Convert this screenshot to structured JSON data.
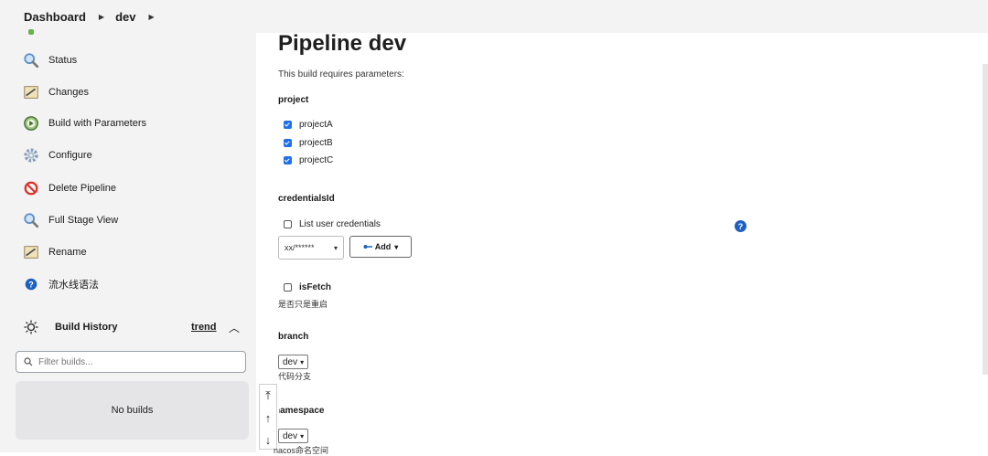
{
  "breadcrumb": [
    "Dashboard",
    "dev"
  ],
  "sidebar": {
    "items": [
      {
        "label": "Status",
        "icon": "magnifier-icon"
      },
      {
        "label": "Changes",
        "icon": "notepad-icon"
      },
      {
        "label": "Build with Parameters",
        "icon": "clock-play-icon"
      },
      {
        "label": "Configure",
        "icon": "gear-icon"
      },
      {
        "label": "Delete Pipeline",
        "icon": "no-entry-icon"
      },
      {
        "label": "Full Stage View",
        "icon": "magnifier-icon"
      },
      {
        "label": "Rename",
        "icon": "notepad-icon"
      },
      {
        "label": "流水线语法",
        "icon": "help-icon"
      }
    ]
  },
  "build_history": {
    "title": "Build History",
    "trend_label": "trend",
    "filter_placeholder": "Filter builds...",
    "empty_text": "No builds"
  },
  "main": {
    "title": "Pipeline dev",
    "subtitle": "This build requires parameters:",
    "project": {
      "name": "project",
      "options": [
        {
          "label": "projectA",
          "checked": true
        },
        {
          "label": "projectB",
          "checked": true
        },
        {
          "label": "projectC",
          "checked": true
        }
      ]
    },
    "credentials": {
      "name": "credentialsId",
      "list_user_label": "List user credentials",
      "selected": "xx/******",
      "add_label": "Add"
    },
    "isFetch": {
      "name": "isFetch",
      "description": "是否只是重启"
    },
    "branch": {
      "name": "branch",
      "selected": "dev",
      "description": "代码分支"
    },
    "namespace": {
      "name": "namespace",
      "selected": "dev",
      "description": "nacos命名空间"
    }
  },
  "colors": {
    "accent": "#1f6feb",
    "sidebar_bg": "#f3f3f4"
  }
}
